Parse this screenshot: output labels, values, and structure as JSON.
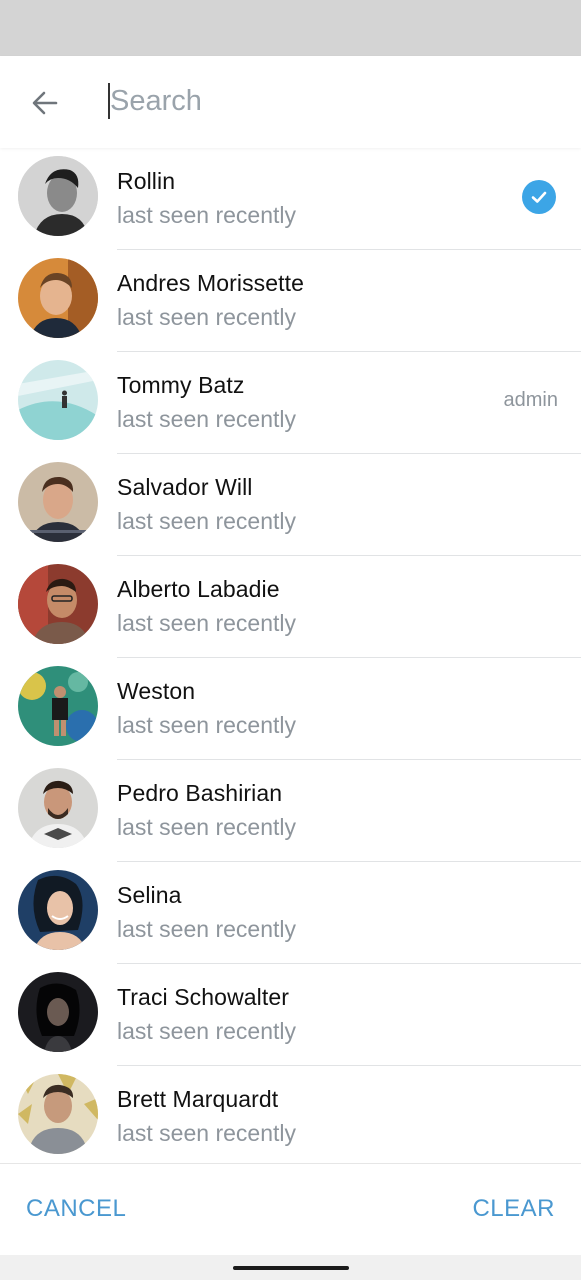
{
  "search": {
    "placeholder": "Search",
    "value": ""
  },
  "contacts": [
    {
      "name": "Rollin",
      "status": "last seen recently",
      "selected": true
    },
    {
      "name": "Andres Morissette",
      "status": "last seen recently"
    },
    {
      "name": "Tommy Batz",
      "status": "last seen recently",
      "badge": "admin"
    },
    {
      "name": "Salvador Will",
      "status": "last seen recently"
    },
    {
      "name": "Alberto Labadie",
      "status": "last seen recently"
    },
    {
      "name": "Weston",
      "status": "last seen recently"
    },
    {
      "name": "Pedro Bashirian",
      "status": "last seen recently"
    },
    {
      "name": "Selina",
      "status": "last seen recently"
    },
    {
      "name": "Traci Schowalter",
      "status": "last seen recently"
    },
    {
      "name": "Brett Marquardt",
      "status": "last seen recently"
    }
  ],
  "actions": {
    "cancel": "CANCEL",
    "clear": "CLEAR"
  },
  "icons": {
    "back": "arrow-left-icon",
    "check": "checkmark-circle-icon"
  },
  "colors": {
    "accent": "#4a98d0",
    "check": "#3ca5e6",
    "secondary_text": "#8e959c"
  }
}
